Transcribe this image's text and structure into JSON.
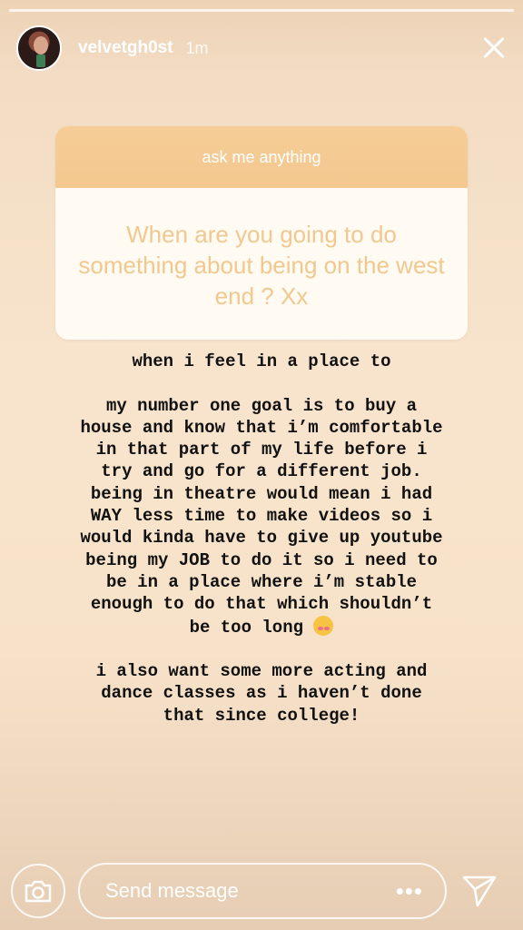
{
  "story": {
    "segments": 1,
    "progress": 0.0
  },
  "header": {
    "username": "velvetgh0st",
    "time": "1m"
  },
  "question_sticker": {
    "title": "ask me anything",
    "question": "When are you going to do something about being on the west end ? Xx"
  },
  "answer": {
    "paragraphs": [
      "when i feel in a place to",
      "my number one goal is to buy a house and know that i’m comfortable in that part of my life before i try and go for a different job. being in theatre would mean i had WAY less time to make videos so i would kinda have to give up youtube being my JOB to do it so i need to be in a place where i’m stable enough to do that which shouldn’t be too long",
      "i also want some more acting and dance classes as i haven’t done that since college!"
    ],
    "emoji": "smiling-face-with-hearts"
  },
  "footer": {
    "message_placeholder": "Send message",
    "more_label": "•••"
  },
  "colors": {
    "background": "#f7e2c9",
    "sticker_header": "#f5ca92",
    "sticker_text": "#f1c88f"
  }
}
